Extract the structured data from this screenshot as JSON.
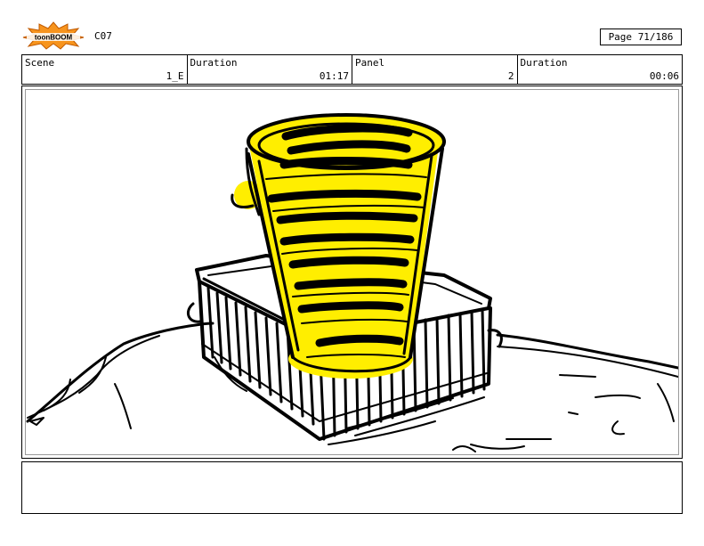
{
  "header": {
    "logo_text": "toonBOOM",
    "code": "C07",
    "page_label": "Page",
    "page_number": "71/186"
  },
  "info": {
    "scene_label": "Scene",
    "scene_value": "1_E",
    "duration_label": "Duration",
    "duration_value": "01:17",
    "panel_label": "Panel",
    "panel_value": "2",
    "panel_duration_label": "Duration",
    "panel_duration_value": "00:06"
  },
  "panel": {
    "drawing": "storyboard-sketch",
    "highlight_color": "#ffee00"
  },
  "notes": {
    "text": ""
  }
}
